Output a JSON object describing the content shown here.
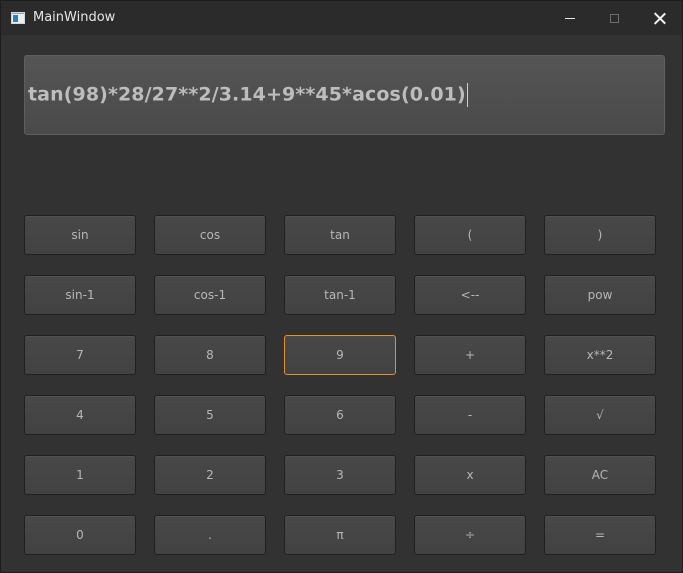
{
  "window": {
    "title": "MainWindow",
    "minimize_icon": "minimize-icon",
    "maximize_icon": "maximize-icon",
    "close_icon": "close-icon"
  },
  "display": {
    "expression": "tan(98)*28/27**2/3.14+9**45*acos(0.01)"
  },
  "keys": {
    "sin": "sin",
    "cos": "cos",
    "tan": "tan",
    "lparen": "(",
    "rparen": ")",
    "asin": "sin-1",
    "acos": "cos-1",
    "atan": "tan-1",
    "backspace": "<--",
    "pow": "pow",
    "seven": "7",
    "eight": "8",
    "nine": "9",
    "plus": "+",
    "square": "x**2",
    "four": "4",
    "five": "5",
    "six": "6",
    "minus": "-",
    "sqrt": "√",
    "one": "1",
    "two": "2",
    "three": "3",
    "multiply": "x",
    "clear": "AC",
    "zero": "0",
    "dot": ".",
    "pi": "π",
    "divide": "÷",
    "equals": "="
  },
  "colors": {
    "focus_accent": "#e0922f"
  }
}
